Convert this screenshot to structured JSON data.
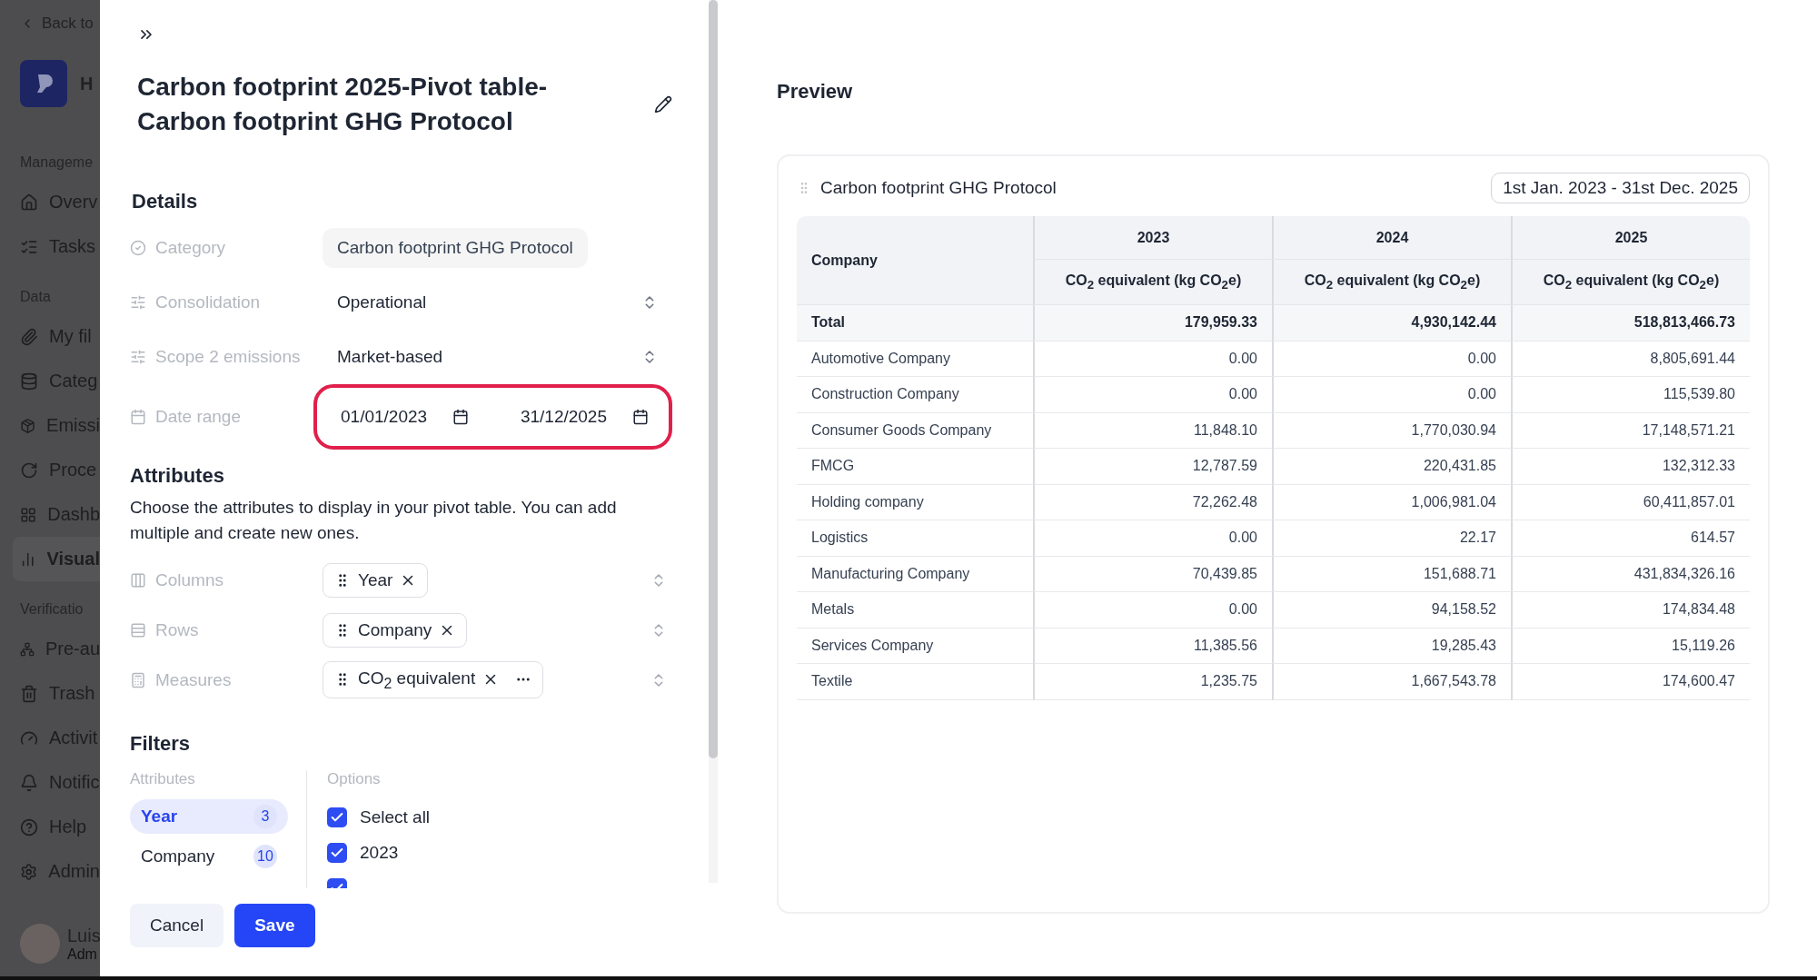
{
  "sidebar": {
    "back_link": "Back to",
    "workspace": "H",
    "sections": [
      {
        "title": "Manageme",
        "items": [
          {
            "label": "Overv",
            "selected": false
          },
          {
            "label": "Tasks",
            "selected": false
          }
        ]
      },
      {
        "title": "Data",
        "items": [
          {
            "label": "My fil",
            "selected": false
          },
          {
            "label": "Categ",
            "selected": false
          },
          {
            "label": "Emissi",
            "selected": false
          },
          {
            "label": "Proce",
            "selected": false
          },
          {
            "label": "Dashb",
            "selected": false
          },
          {
            "label": "Visual",
            "selected": true
          }
        ]
      },
      {
        "title": "Verificatio",
        "items": [
          {
            "label": "Pre-au",
            "selected": false
          },
          {
            "label": "Trash",
            "selected": false
          },
          {
            "label": "Activit",
            "selected": false
          },
          {
            "label": "Notific",
            "selected": false
          },
          {
            "label": "Help",
            "selected": false
          },
          {
            "label": "Admin",
            "selected": false
          }
        ]
      }
    ],
    "user": {
      "name": "Luis",
      "role": "Adm"
    }
  },
  "panel": {
    "title": "Carbon footprint 2025-Pivot table-Carbon footprint GHG Protocol",
    "details": {
      "heading": "Details",
      "fields": [
        {
          "kind": "static",
          "label": "Category",
          "value": "Carbon footprint GHG Protocol"
        },
        {
          "kind": "select",
          "label": "Consolidation",
          "value": "Operational"
        },
        {
          "kind": "select",
          "label": "Scope 2 emissions",
          "value": "Market-based"
        },
        {
          "kind": "daterange",
          "label": "Date range",
          "start": "01/01/2023",
          "end": "31/12/2025",
          "highlighted": true
        }
      ]
    },
    "attributes": {
      "heading": "Attributes",
      "description": "Choose the attributes to display in your pivot table. You can add multiple and create new ones.",
      "fields": [
        {
          "label": "Columns",
          "chips": [
            {
              "label": "Year",
              "more": false
            }
          ]
        },
        {
          "label": "Rows",
          "chips": [
            {
              "label": "Company",
              "more": false
            }
          ]
        },
        {
          "label": "Measures",
          "chips": [
            {
              "label": "CO$_{2}$ equivalent",
              "more": true
            }
          ]
        }
      ]
    },
    "filters": {
      "heading": "Filters",
      "attributes_label": "Attributes",
      "options_label": "Options",
      "attributes": [
        {
          "label": "Year",
          "count": "3",
          "selected": true
        },
        {
          "label": "Company",
          "count": "10",
          "selected": false
        }
      ],
      "options": [
        {
          "label": "Select all",
          "checked": true
        },
        {
          "label": "2023",
          "checked": true
        },
        {
          "checked": true
        }
      ]
    },
    "buttons": [
      {
        "label": "Cancel",
        "kind": "secondary"
      },
      {
        "label": "Save",
        "kind": "primary"
      }
    ]
  },
  "preview": {
    "heading": "Preview",
    "card_title": "Carbon footprint GHG Protocol",
    "date_range": "1st Jan. 2023 - 31st Dec. 2025",
    "table": {
      "row_header": "Company",
      "years": [
        "2023",
        "2024",
        "2025"
      ],
      "measures": [
        "CO$_{2}$ equivalent (kg CO$_{2}$e)",
        "CO$_{2}$ equivalent (kg CO$_{2}$e)",
        "CO$_{2}$ equivalent (kg CO$_{2}$e)"
      ],
      "total": {
        "label": "Total",
        "values": [
          "179,959.33",
          "4,930,142.44",
          "518,813,466.73"
        ]
      },
      "rows": [
        {
          "label": "Automotive Company",
          "values": [
            "0.00",
            "0.00",
            "8,805,691.44"
          ]
        },
        {
          "label": "Construction Company",
          "values": [
            "0.00",
            "0.00",
            "115,539.80"
          ]
        },
        {
          "label": "Consumer Goods Company",
          "values": [
            "11,848.10",
            "1,770,030.94",
            "17,148,571.21"
          ]
        },
        {
          "label": "FMCG",
          "values": [
            "12,787.59",
            "220,431.85",
            "132,312.33"
          ]
        },
        {
          "label": "Holding company",
          "values": [
            "72,262.48",
            "1,006,981.04",
            "60,411,857.01"
          ]
        },
        {
          "label": "Logistics",
          "values": [
            "0.00",
            "22.17",
            "614.57"
          ]
        },
        {
          "label": "Manufacturing Company",
          "values": [
            "70,439.85",
            "151,688.71",
            "431,834,326.16"
          ]
        },
        {
          "label": "Metals",
          "values": [
            "0.00",
            "94,158.52",
            "174,834.48"
          ]
        },
        {
          "label": "Services Company",
          "values": [
            "11,385.56",
            "19,285.43",
            "15,119.26"
          ]
        },
        {
          "label": "Textile",
          "values": [
            "1,235.75",
            "1,667,543.78",
            "174,600.47"
          ]
        }
      ]
    }
  }
}
